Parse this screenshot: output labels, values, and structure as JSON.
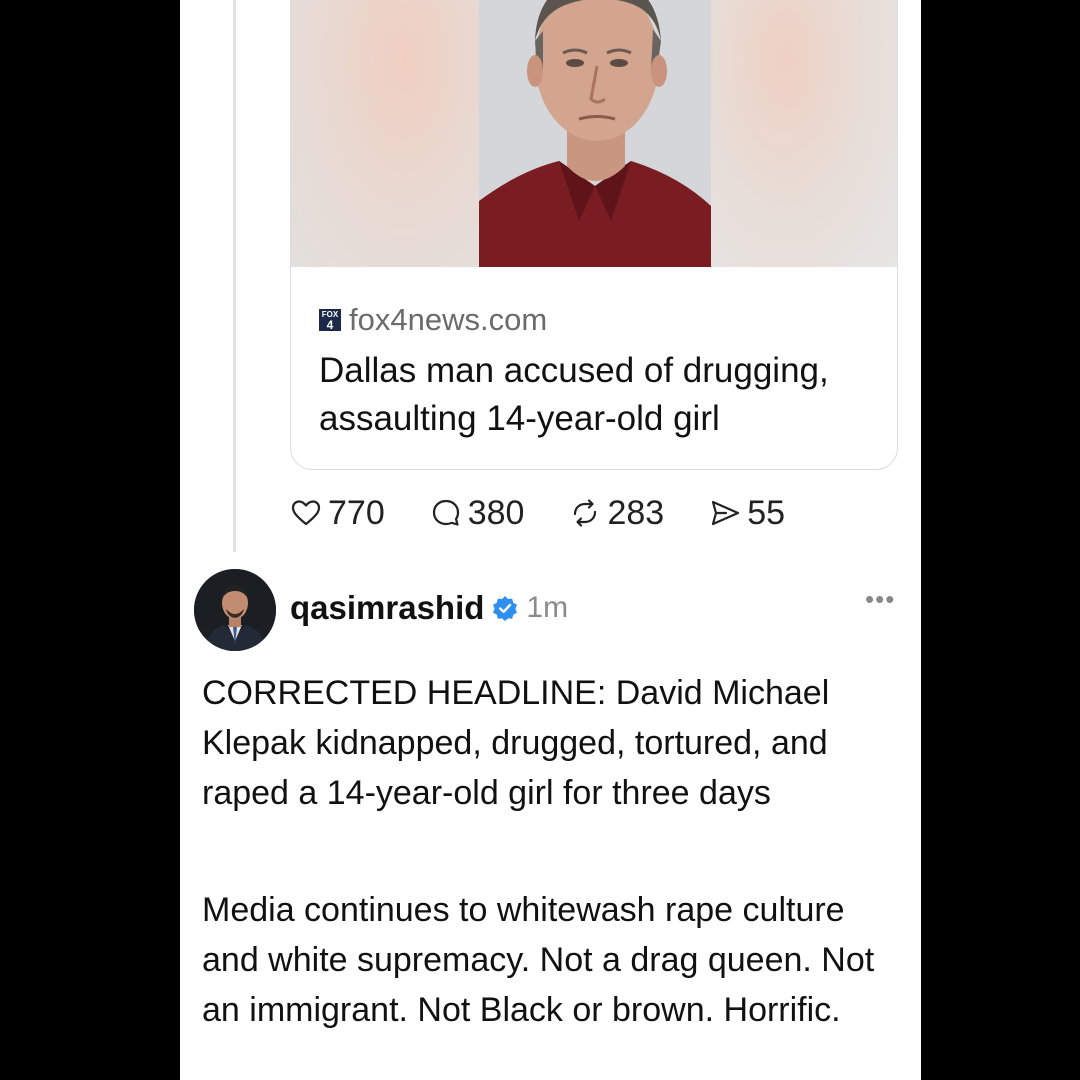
{
  "link_card": {
    "source_domain": "fox4news.com",
    "source_icon": "fox4-logo-icon",
    "source_icon_text_top": "FOX",
    "source_icon_text_num": "4",
    "headline": "Dallas man accused of drugging, assaulting 14-year-old girl"
  },
  "actions": {
    "likes": "770",
    "replies": "380",
    "reposts": "283",
    "shares": "55"
  },
  "post": {
    "username": "qasimrashid",
    "timestamp": "1m",
    "more_label": "•••",
    "paragraph_1": "CORRECTED HEADLINE: David Michael Klepak kidnapped, drugged, tortured, and raped a 14-year-old girl for three days",
    "paragraph_2": "Media continues to whitewash rape culture and white supremacy. Not a drag queen. Not an immigrant. Not Black or brown. Horrific."
  },
  "colors": {
    "verified": "#2f8ff0",
    "fox_icon_bg": "#1b2a4a",
    "muted_text": "#6b6b6b"
  }
}
